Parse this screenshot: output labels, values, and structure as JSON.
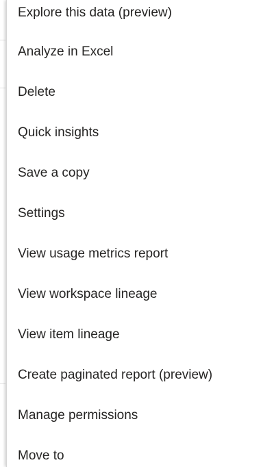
{
  "context_menu": {
    "items": [
      {
        "label": "Explore this data (preview)"
      },
      {
        "label": "Analyze in Excel"
      },
      {
        "label": "Delete"
      },
      {
        "label": "Quick insights"
      },
      {
        "label": "Save a copy"
      },
      {
        "label": "Settings"
      },
      {
        "label": "View usage metrics report"
      },
      {
        "label": "View workspace lineage"
      },
      {
        "label": "View item lineage"
      },
      {
        "label": "Create paginated report (preview)"
      },
      {
        "label": "Manage permissions"
      },
      {
        "label": "Move to"
      }
    ]
  },
  "colors": {
    "menu_background": "#ffffff",
    "text": "#252423",
    "border": "#d6d6d6"
  }
}
